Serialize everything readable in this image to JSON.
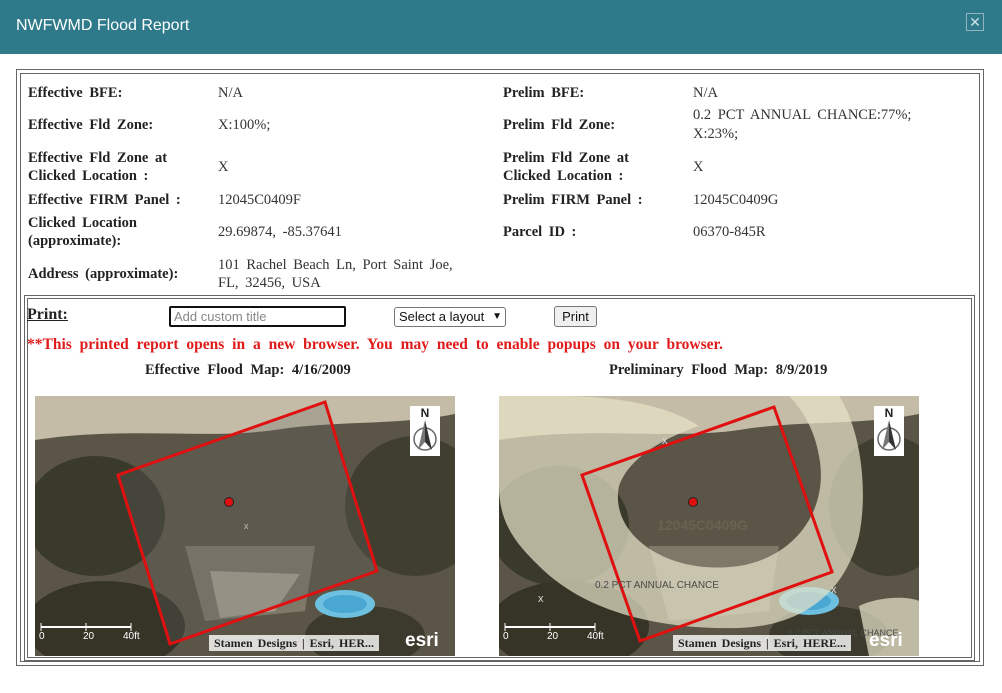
{
  "dialog": {
    "title": "NWFWMD Flood Report",
    "close_icon": "close-icon"
  },
  "report": {
    "left": [
      {
        "label": "Effective BFE:",
        "value": "N/A"
      },
      {
        "label": "Effective Fld Zone:",
        "value": "X:100%;"
      },
      {
        "label_line1": "Effective Fld Zone at",
        "label_line2": "Clicked Location :",
        "value": "X"
      },
      {
        "label": "Effective FIRM Panel :",
        "value": "12045C0409F"
      },
      {
        "label_line1": "Clicked Location",
        "label_line2": "(approximate):",
        "value": "29.69874, -85.37641"
      },
      {
        "label": "Address (approximate):",
        "value_line1": "101 Rachel Beach Ln, Port Saint Joe,",
        "value_line2": "FL, 32456, USA"
      }
    ],
    "right": [
      {
        "label": "Prelim BFE:",
        "value": "N/A"
      },
      {
        "label": "Prelim Fld Zone:",
        "value_line1": "0.2 PCT ANNUAL CHANCE:77%;",
        "value_line2": "X:23%;"
      },
      {
        "label_line1": "Prelim Fld Zone at",
        "label_line2": "Clicked Location :",
        "value": "X"
      },
      {
        "label": "Prelim FIRM Panel :",
        "value": "12045C0409G"
      },
      {
        "label": "Parcel ID :",
        "value": "06370-845R"
      }
    ]
  },
  "print": {
    "label": "Print:",
    "title_placeholder": "Add custom title",
    "layout_select": "Select a layout",
    "button": "Print",
    "note": "**This printed report opens in a new browser. You may need to enable popups on your browser."
  },
  "maps": [
    {
      "title": "Effective Flood Map: 4/16/2009",
      "attribution": "Stamen Designs | Esri, HER...",
      "logo": "esri",
      "north": "N",
      "scale_labels": [
        "0",
        "20",
        "40ft"
      ]
    },
    {
      "title": "Preliminary Flood Map: 8/9/2019",
      "attribution": "Stamen Designs | Esri, HERE...",
      "logo": "esri",
      "north": "N",
      "scale_labels": [
        "0",
        "20",
        "40ft"
      ],
      "panel_label": "12045C0409G",
      "zone_label": "0.2 PCT ANNUAL CHANCE",
      "zone_label_corner": "0.2 PCT ANNUAL CHANCE"
    }
  ],
  "colors": {
    "titlebar": "#2e7a8a",
    "note": "#e01b1b",
    "panel_outline": "#e01010",
    "point": "#e01010"
  }
}
